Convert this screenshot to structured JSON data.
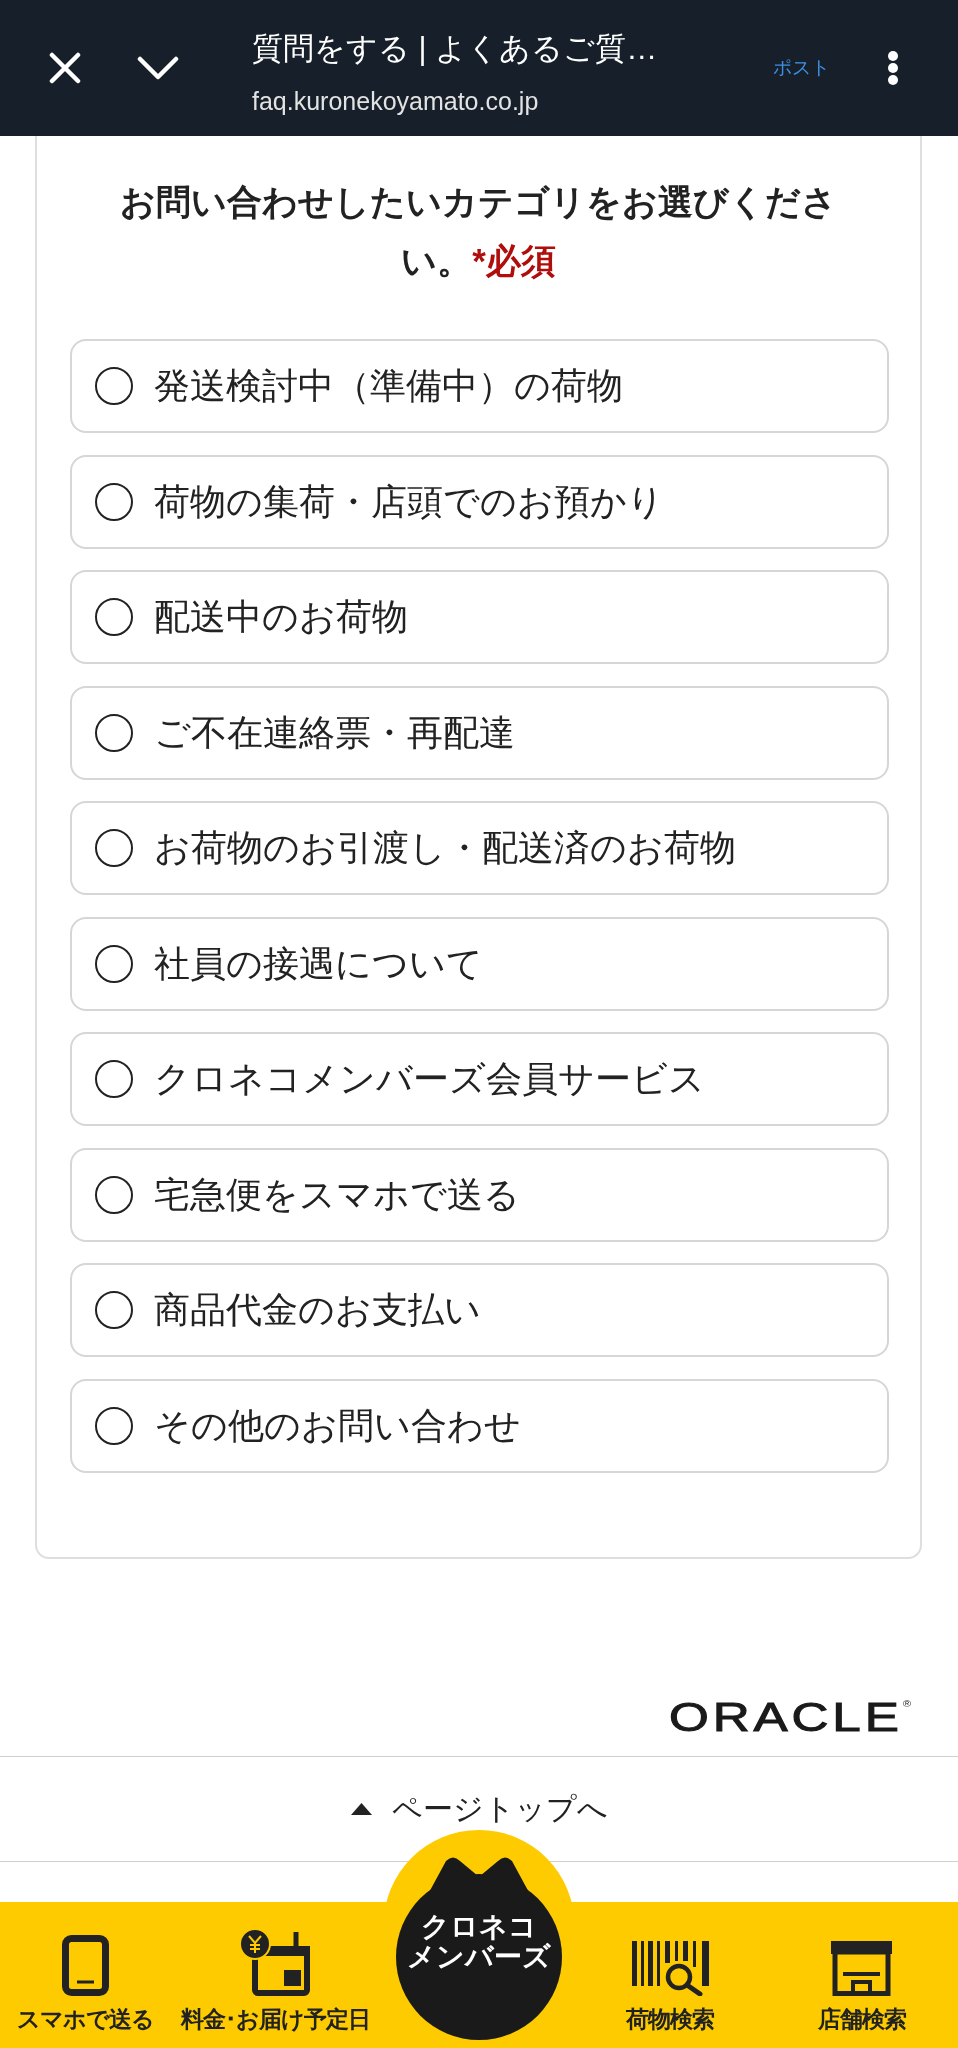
{
  "browser_bar": {
    "title": "質問をする | よくあるご質…",
    "url": "faq.kuronekoyamato.co.jp",
    "action": "ポスト"
  },
  "form": {
    "question": "お問い合わせしたいカテゴリをお選びください。",
    "required_mark": "*必須",
    "options": [
      {
        "label": "発送検討中（準備中）の荷物",
        "selected": false
      },
      {
        "label": "荷物の集荷・店頭でのお預かり",
        "selected": false
      },
      {
        "label": "配送中のお荷物",
        "selected": false
      },
      {
        "label": "ご不在連絡票・再配達",
        "selected": false
      },
      {
        "label": "お荷物のお引渡し・配送済のお荷物",
        "selected": false
      },
      {
        "label": "社員の接遇について",
        "selected": false
      },
      {
        "label": "クロネコメンバーズ会員サービス",
        "selected": false
      },
      {
        "label": "宅急便をスマホで送る",
        "selected": false
      },
      {
        "label": "商品代金のお支払い",
        "selected": false
      },
      {
        "label": "その他のお問い合わせ",
        "selected": false
      }
    ]
  },
  "footer": {
    "logo": "ORACLE$^{®}$",
    "page_top_link": "ページトップへ"
  },
  "bottom_nav": {
    "items": [
      {
        "label": "スマホで送る"
      },
      {
        "label": "料金･お届け予定日"
      },
      {
        "label": "荷物検索"
      },
      {
        "label": "店舗検索"
      }
    ],
    "members_button": {
      "label_lines": [
        "クロネコ",
        "メンバーズ"
      ]
    }
  }
}
